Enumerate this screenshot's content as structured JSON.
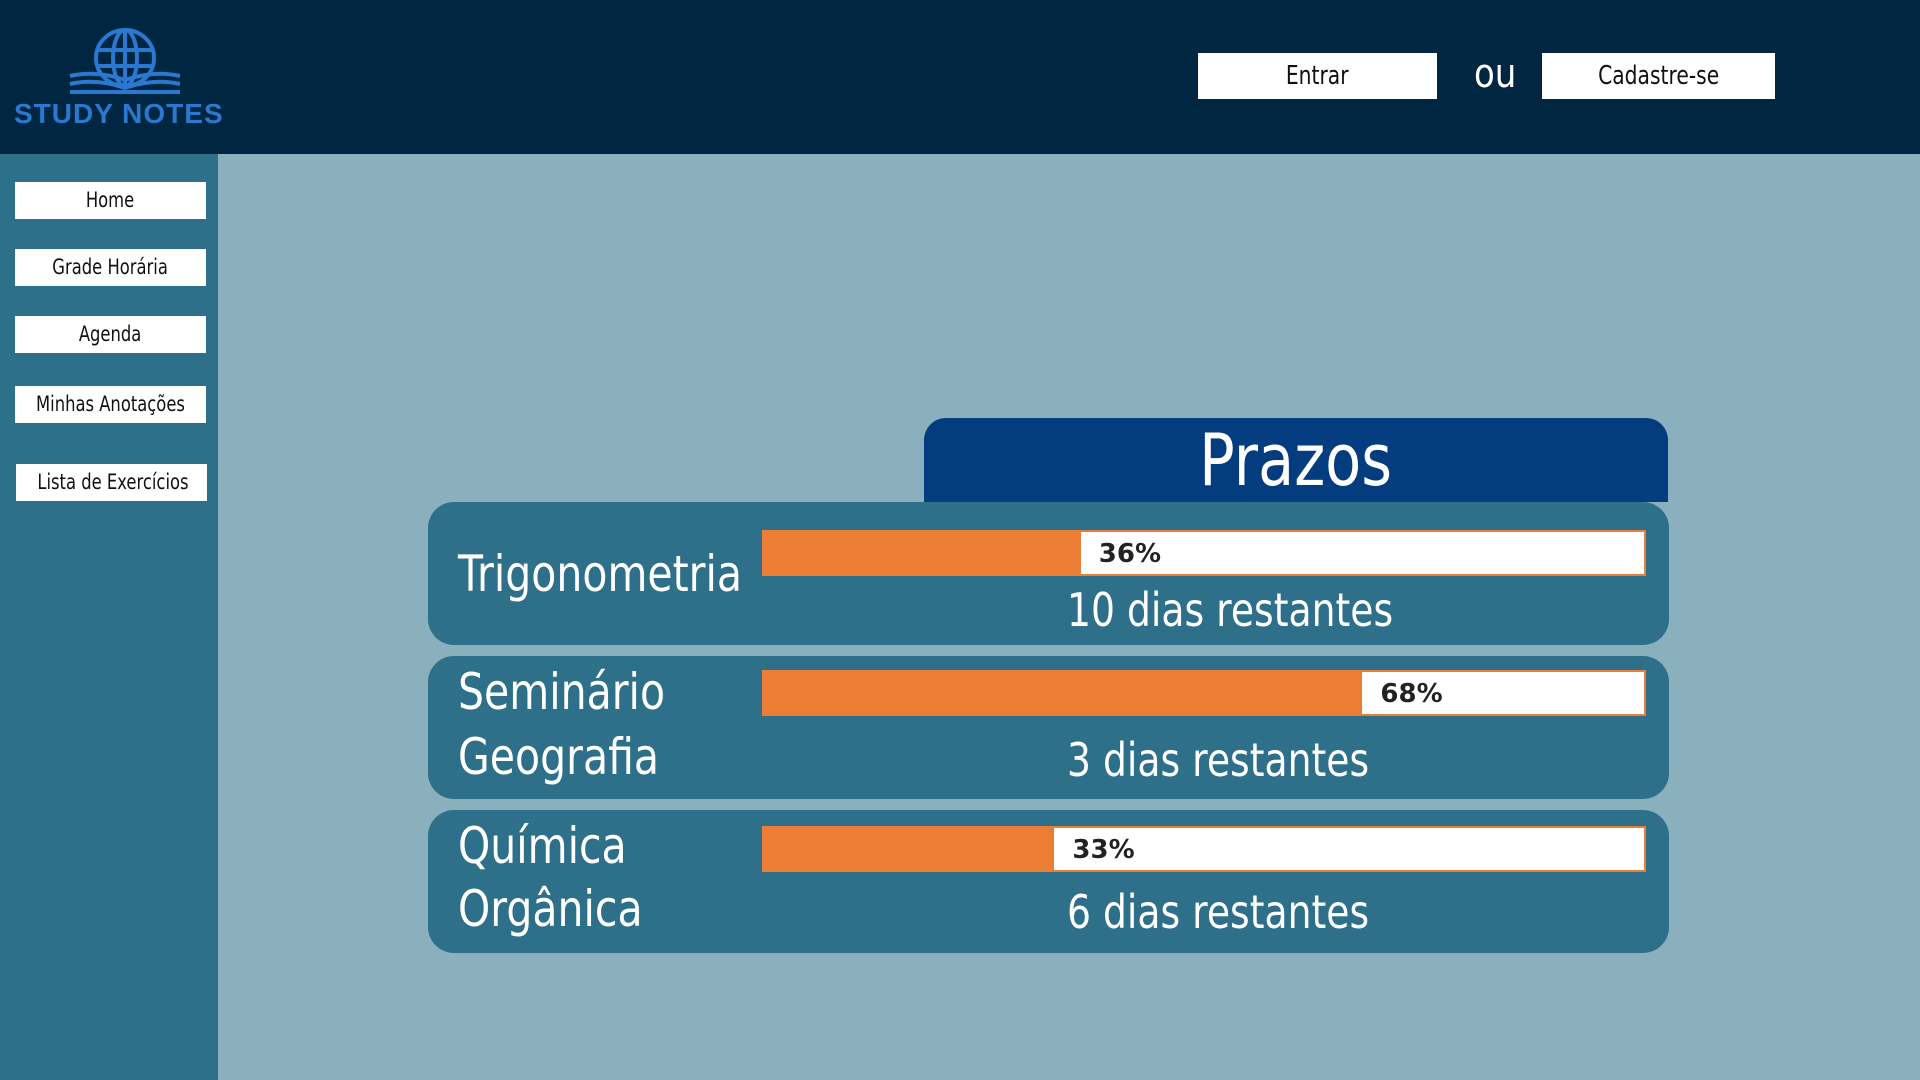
{
  "header": {
    "logo_text": "STUDY NOTES",
    "login_label": "Entrar",
    "or_label": "ou",
    "signup_label": "Cadastre-se"
  },
  "sidebar": {
    "items": [
      {
        "label": "Home"
      },
      {
        "label": "Grade Horária"
      },
      {
        "label": "Agenda"
      },
      {
        "label": "Minhas Anotações"
      },
      {
        "label": "Lista de Exercícios"
      }
    ]
  },
  "main": {
    "title": "Prazos",
    "deadlines": [
      {
        "subject_line1": "Trigonometria",
        "subject_line2": "",
        "progress": 0.36,
        "progress_label": "36%",
        "remaining": "10 dias restantes"
      },
      {
        "subject_line1": "Seminário",
        "subject_line2": "Geografia",
        "progress": 0.68,
        "progress_label": "68%",
        "remaining": "3 dias restantes"
      },
      {
        "subject_line1": "Química",
        "subject_line2": "Orgânica",
        "progress": 0.33,
        "progress_label": "33%",
        "remaining": "6 dias restantes"
      }
    ]
  },
  "colors": {
    "header_bg": "#012641",
    "sidebar_bg": "#2e6f89",
    "page_bg": "#8aafbd",
    "title_tab_bg": "#033c7f",
    "progress_fill": "#ec7d34",
    "logo_blue": "#2a78cf"
  }
}
